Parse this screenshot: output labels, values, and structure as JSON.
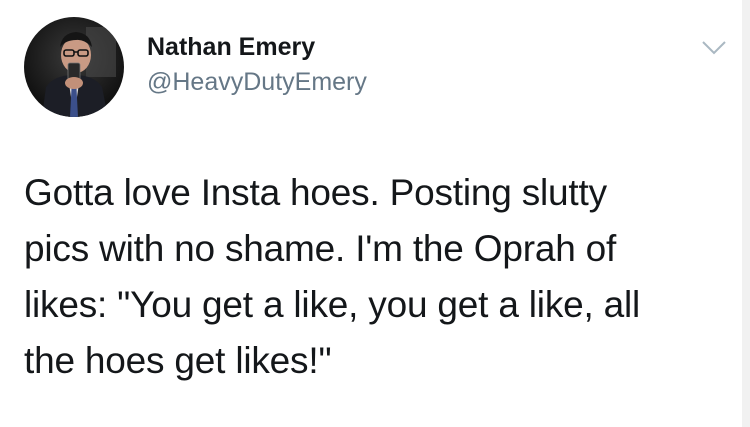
{
  "tweet": {
    "author": {
      "display_name": "Nathan Emery",
      "handle": "@HeavyDutyEmery",
      "avatar_icon": "profile-photo"
    },
    "menu_icon": "chevron-down-icon",
    "text": "Gotta love Insta hoes. Posting slutty\npics with no shame. I'm the Oprah of\nlikes: \"You get a like, you get a like, all\nthe hoes get likes!\""
  },
  "colors": {
    "text_primary": "#14171a",
    "text_secondary": "#657786",
    "caret": "#aab8c2",
    "background": "#ffffff"
  }
}
